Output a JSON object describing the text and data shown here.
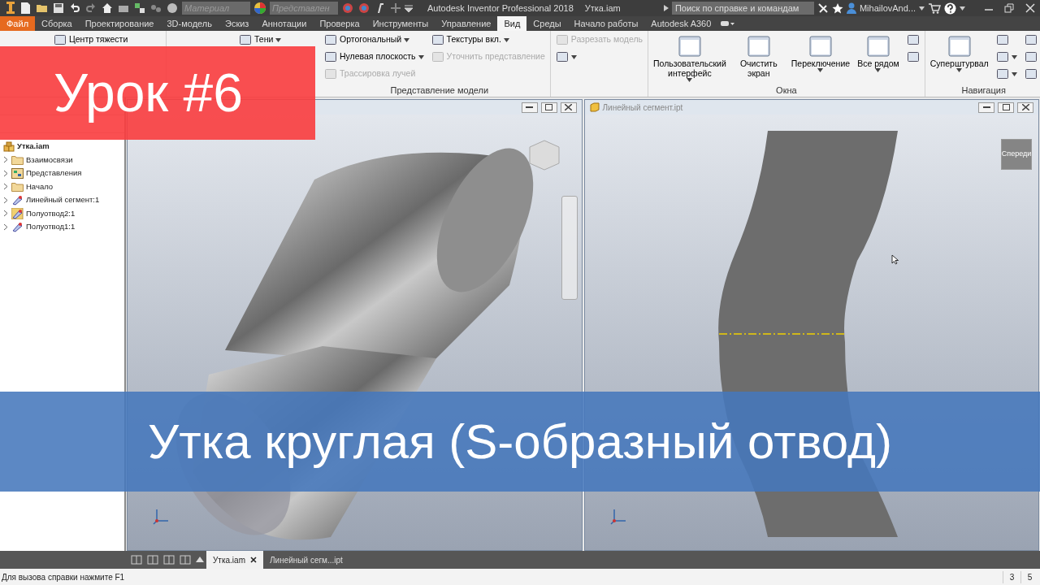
{
  "title_bar": {
    "material_placeholder": "Материал",
    "appearance_placeholder": "Представлен",
    "title": "Autodesk Inventor Professional 2018",
    "document": "Утка.iam",
    "search_placeholder": "Поиск по справке и командам",
    "user": "MihailovAnd..."
  },
  "menu_tabs": [
    {
      "label": "Файл",
      "kind": "file",
      "selected": false
    },
    {
      "label": "Сборка",
      "kind": "tab",
      "selected": false
    },
    {
      "label": "Проектирование",
      "kind": "tab",
      "selected": false
    },
    {
      "label": "3D-модель",
      "kind": "tab",
      "selected": false
    },
    {
      "label": "Эскиз",
      "kind": "tab",
      "selected": false
    },
    {
      "label": "Аннотации",
      "kind": "tab",
      "selected": false
    },
    {
      "label": "Проверка",
      "kind": "tab",
      "selected": false
    },
    {
      "label": "Инструменты",
      "kind": "tab",
      "selected": false
    },
    {
      "label": "Управление",
      "kind": "tab",
      "selected": false
    },
    {
      "label": "Вид",
      "kind": "tab",
      "selected": true
    },
    {
      "label": "Среды",
      "kind": "tab",
      "selected": false
    },
    {
      "label": "Начало работы",
      "kind": "tab",
      "selected": false
    },
    {
      "label": "Autodesk A360",
      "kind": "tab",
      "selected": false
    }
  ],
  "ribbon_panels": [
    {
      "columns": [
        {
          "kind": "covered"
        },
        {
          "kind": "small",
          "items": [
            {
              "label": "Центр тяжести",
              "dropdown": false,
              "disabled": false
            }
          ]
        }
      ]
    },
    {
      "title": "Представление модели",
      "columns": [
        {
          "kind": "covered"
        },
        {
          "kind": "small",
          "items": [
            {
              "label": "Тени",
              "dropdown": true,
              "disabled": false
            }
          ]
        },
        {
          "kind": "small",
          "items": [
            {
              "label": "Ортогональный",
              "dropdown": true,
              "disabled": false
            },
            {
              "label": "Нулевая плоскость",
              "dropdown": true,
              "disabled": false
            },
            {
              "label": "Трассировка лучей",
              "dropdown": false,
              "disabled": true
            }
          ]
        },
        {
          "kind": "small",
          "items": [
            {
              "label": "Текстуры вкл.",
              "dropdown": true,
              "disabled": false
            },
            {
              "label": "Уточнить представление",
              "dropdown": false,
              "disabled": true
            }
          ]
        }
      ]
    },
    {
      "columns": [
        {
          "kind": "small",
          "items": [
            {
              "label": "Разрезать модель",
              "dropdown": false,
              "disabled": true
            },
            {
              "dropdown": true,
              "disabled": false
            }
          ]
        }
      ]
    },
    {
      "title": "Окна",
      "columns": [
        {
          "kind": "large",
          "items": [
            {
              "label": "Пользовательский интерфейс",
              "dropdown": true,
              "disabled": false
            }
          ]
        },
        {
          "kind": "large",
          "items": [
            {
              "label": "Очистить экран",
              "dropdown": false,
              "disabled": false
            }
          ]
        },
        {
          "kind": "large",
          "items": [
            {
              "label": "Переключение",
              "dropdown": true,
              "disabled": false
            }
          ]
        },
        {
          "kind": "large",
          "items": [
            {
              "label": "Все рядом",
              "dropdown": true,
              "disabled": false
            }
          ]
        },
        {
          "kind": "small",
          "items": [
            {
              "dropdown": false,
              "disabled": false
            },
            {
              "dropdown": false,
              "disabled": false
            }
          ]
        }
      ]
    },
    {
      "title": "Навигация",
      "columns": [
        {
          "kind": "large",
          "items": [
            {
              "label": "Суперштурвал",
              "dropdown": true,
              "disabled": false
            }
          ]
        },
        {
          "kind": "small",
          "items": [
            {
              "dropdown": false,
              "disabled": false
            },
            {
              "dropdown": true,
              "disabled": false
            },
            {
              "dropdown": true,
              "disabled": false
            }
          ]
        },
        {
          "kind": "small",
          "items": [
            {
              "dropdown": false,
              "disabled": false
            },
            {
              "dropdown": false,
              "disabled": false
            },
            {
              "dropdown": false,
              "disabled": false
            }
          ]
        }
      ]
    }
  ],
  "browser": {
    "tree": {
      "label": "Утка.iam",
      "kind": "assembly",
      "children": [
        {
          "label": "Взаимосвязи",
          "kind": "folder"
        },
        {
          "label": "Представления",
          "kind": "views"
        },
        {
          "label": "Начало",
          "kind": "folder"
        },
        {
          "label": "Линейный сегмент:1",
          "kind": "part"
        },
        {
          "label": "Полуотвод2:1",
          "kind": "part-grounded"
        },
        {
          "label": "Полуотвод1:1",
          "kind": "part"
        }
      ]
    }
  },
  "viewports": [
    {
      "kind": "assembly"
    },
    {
      "kind": "part",
      "title": "Линейный сегмент.ipt",
      "viewcube_label": "Спереди"
    }
  ],
  "document_tabs": [
    {
      "label": "Утка.iam",
      "selected": true
    },
    {
      "label": "Линейный сегм...ipt",
      "selected": false
    }
  ],
  "status_bar": {
    "text": "Для вызова справки нажмите F1",
    "fields": [
      "3",
      "5"
    ]
  },
  "overlays": {
    "lesson": "Урок #6",
    "title": "Утка круглая (S-образный отвод)"
  }
}
